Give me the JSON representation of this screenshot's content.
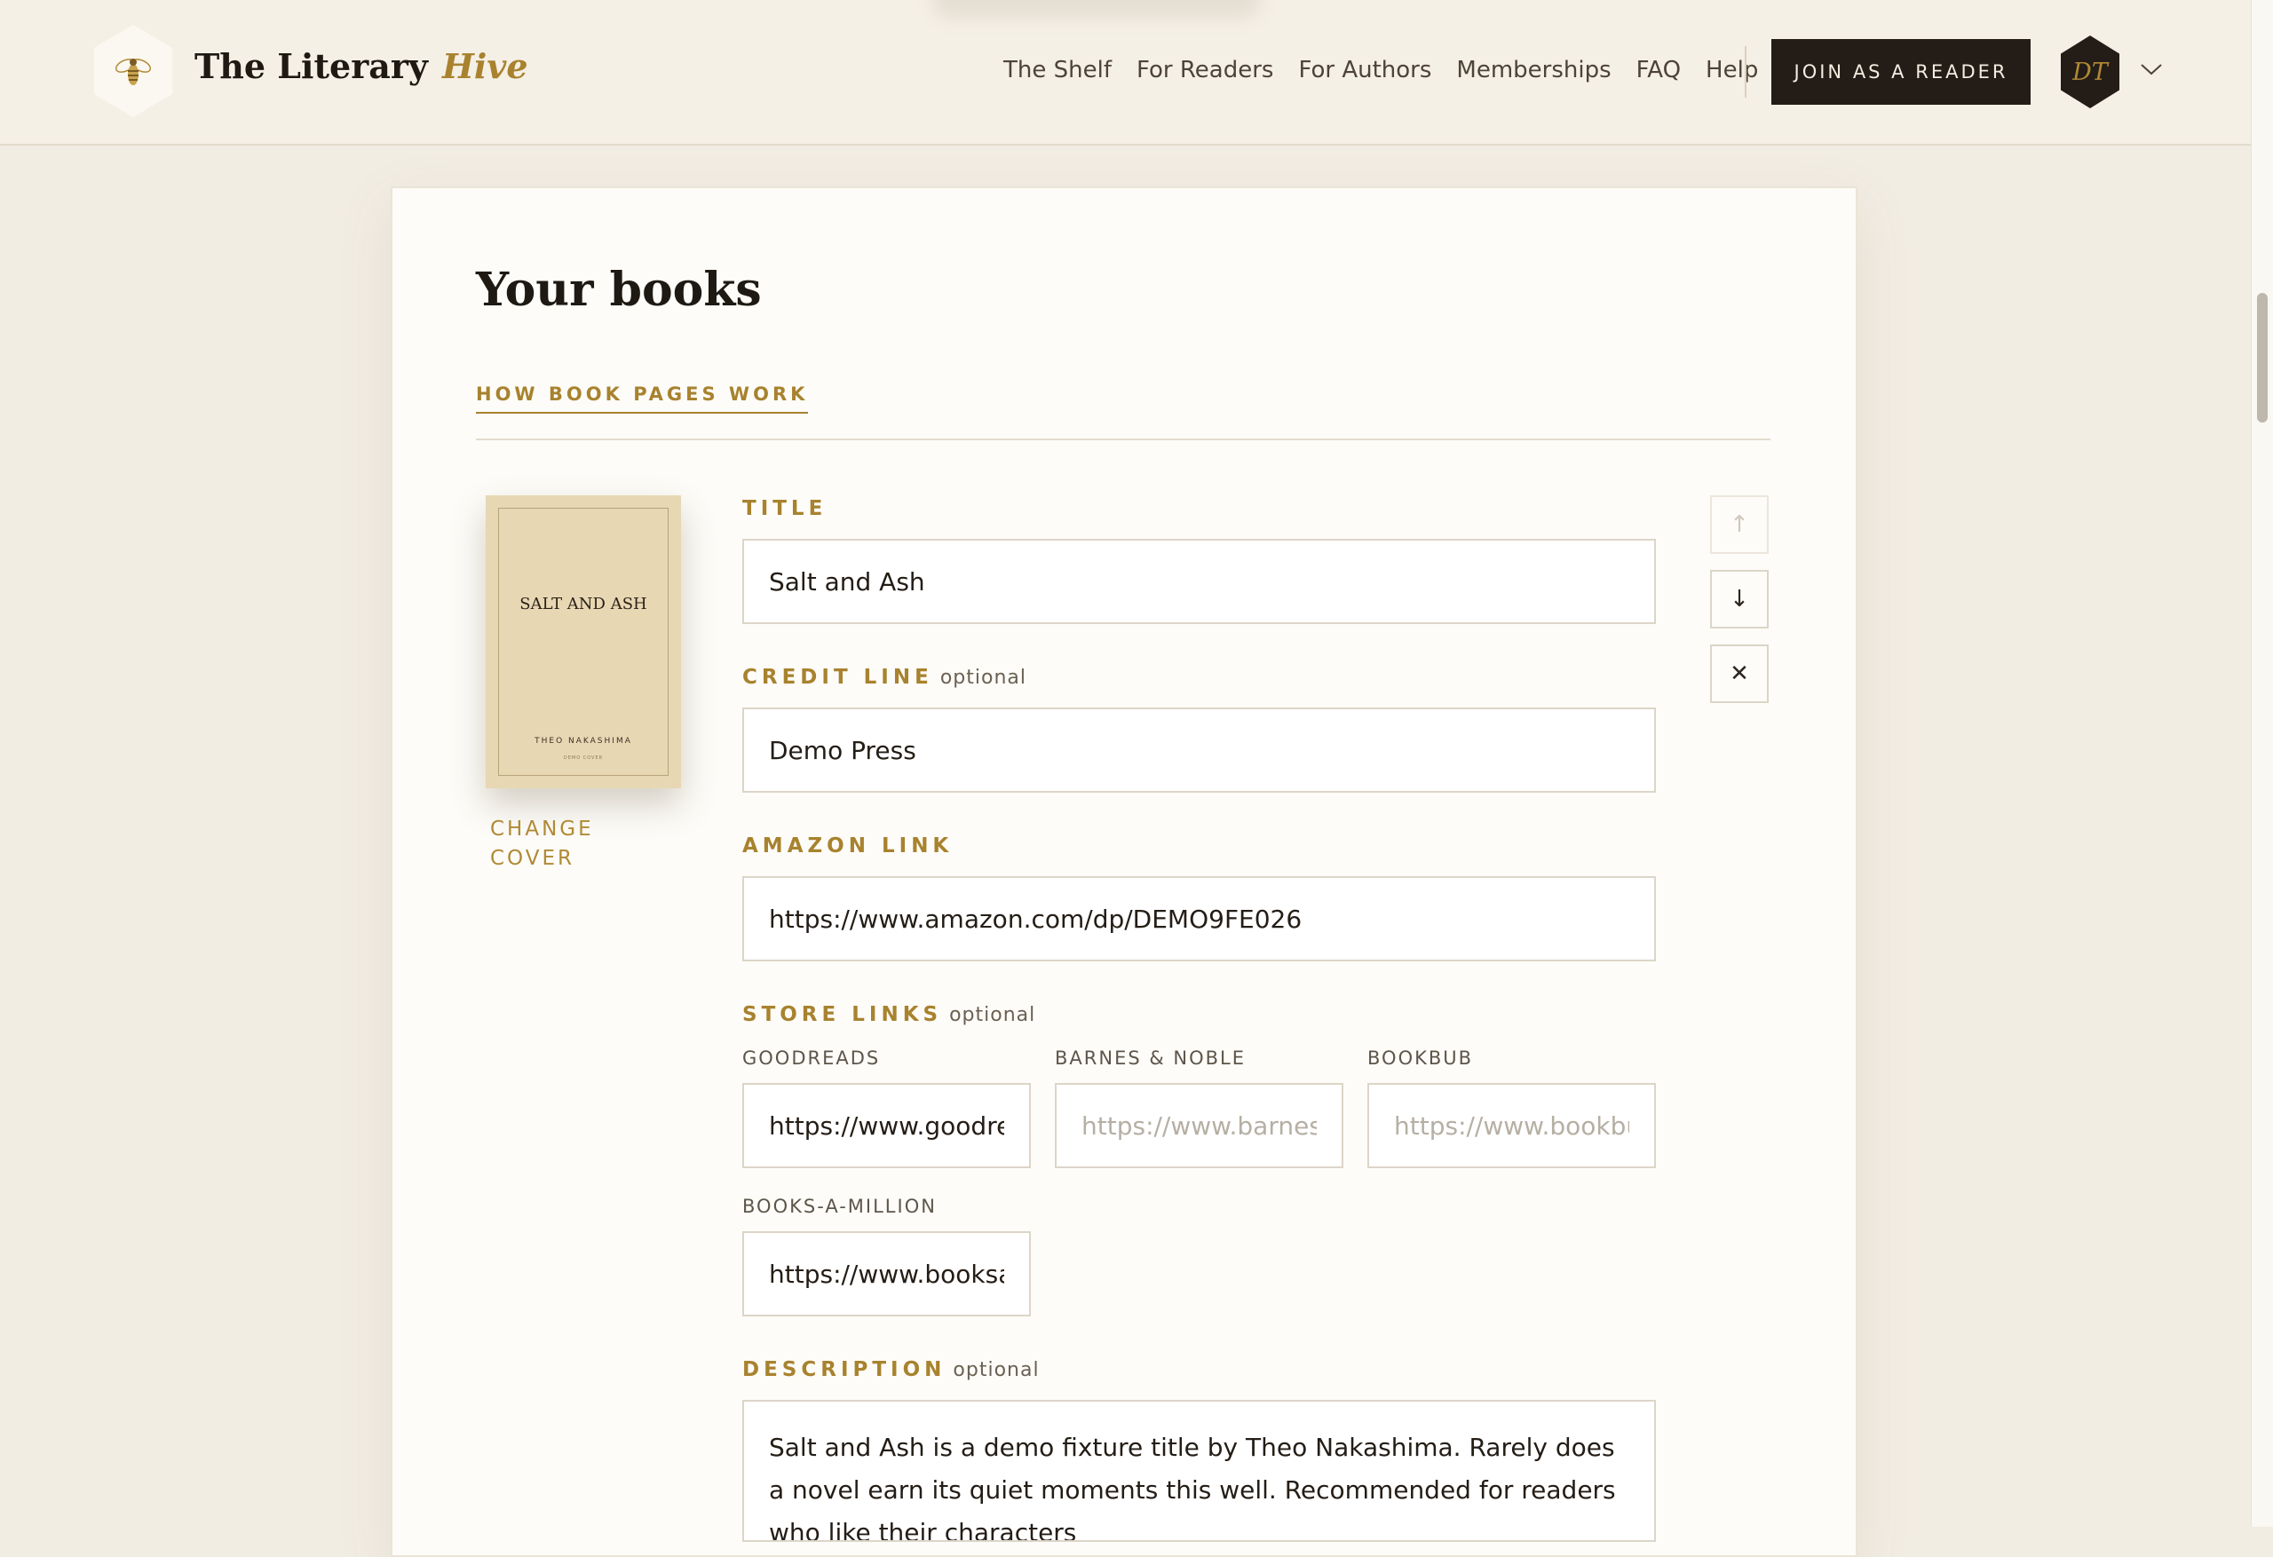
{
  "header": {
    "brand_main": "The Literary",
    "brand_accent": "Hive",
    "nav": [
      "The Shelf",
      "For Readers",
      "For Authors",
      "Memberships",
      "FAQ",
      "Help"
    ],
    "join_label": "JOIN AS A READER",
    "avatar_initials": "DT"
  },
  "page": {
    "title": "Your books",
    "how_link": "HOW BOOK PAGES WORK"
  },
  "book": {
    "cover": {
      "title": "SALT AND ASH",
      "author": "THEO NAKASHIMA",
      "mark": "DEMO COVER",
      "change_label": "CHANGE COVER"
    },
    "title_label": "TITLE",
    "title_value": "Salt and Ash",
    "credit_label": "CREDIT LINE",
    "credit_value": "Demo Press",
    "optional": "optional",
    "amazon_label": "AMAZON LINK",
    "amazon_value": "https://www.amazon.com/dp/DEMO9FE026",
    "store_label": "STORE LINKS",
    "goodreads_label": "GOODREADS",
    "goodreads_value": "https://www.goodrea",
    "bn_label": "BARNES & NOBLE",
    "bn_placeholder": "https://www.barnesa",
    "bookbub_label": "BOOKBUB",
    "bookbub_placeholder": "https://www.bookbu",
    "bam_label": "BOOKS-A-MILLION",
    "bam_value": "https://www.booksan",
    "description_label": "DESCRIPTION",
    "description_value": "Salt and Ash is a demo fixture title by Theo Nakashima. Rarely does a novel earn its quiet moments this well. Recommended for readers who like their characters"
  },
  "controls": {
    "up": "↑",
    "down": "↓",
    "remove": "✕"
  }
}
